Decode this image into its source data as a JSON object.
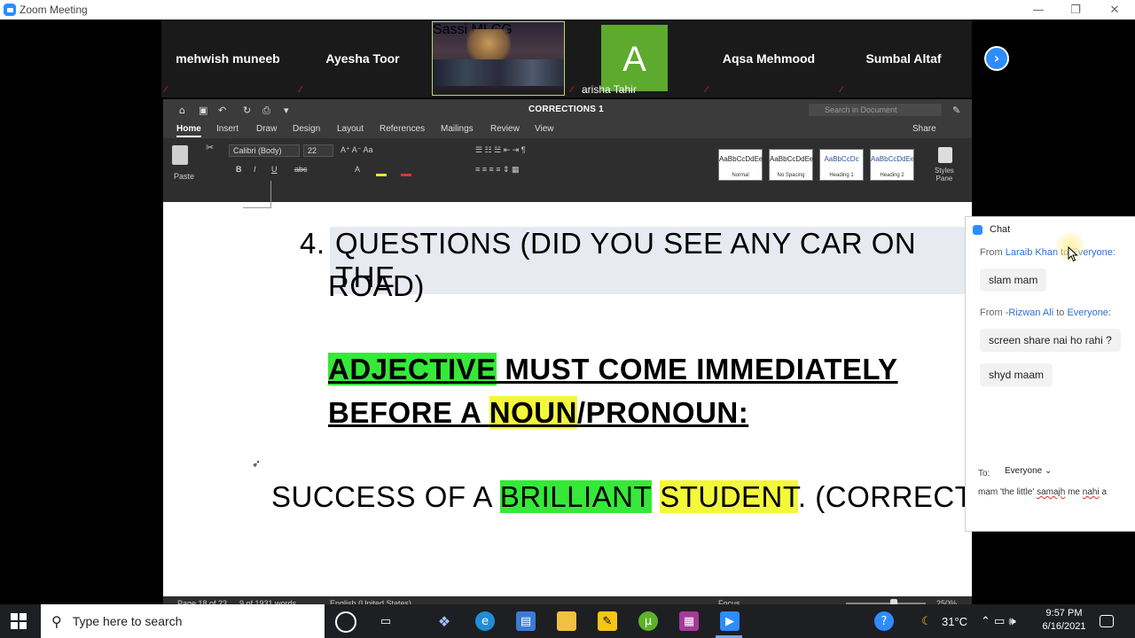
{
  "window": {
    "title": "Zoom Meeting"
  },
  "participants": [
    {
      "name": "mehwish muneeb",
      "muted": true
    },
    {
      "name": "Ayesha Toor",
      "muted": true
    },
    {
      "name": "Sassi MLCG",
      "muted": true,
      "video": true
    },
    {
      "name": "arisha Tahir",
      "muted": true,
      "avatar_letter": "A",
      "avatar_color": "#5eaa2e"
    },
    {
      "name": "Aqsa Mehmood",
      "muted": true
    },
    {
      "name": "Sumbal Altaf",
      "muted": true
    }
  ],
  "word": {
    "doc_title": "CORRECTIONS 1",
    "search_placeholder": "Search in Document",
    "tabs": [
      "Home",
      "Insert",
      "Draw",
      "Design",
      "Layout",
      "References",
      "Mailings",
      "Review",
      "View"
    ],
    "share": "Share",
    "font_name": "Calibri (Body)",
    "font_size": "22",
    "paste": "Paste",
    "styles": [
      {
        "preview": "AaBbCcDdEe",
        "name": "Normal"
      },
      {
        "preview": "AaBbCcDdEe",
        "name": "No Spacing"
      },
      {
        "preview": "AaBbCcDc",
        "name": "Heading 1"
      },
      {
        "preview": "AaBbCcDdEe",
        "name": "Heading 2"
      }
    ],
    "styles_pane": "Styles\nPane",
    "content": {
      "q_num": "4.",
      "q_line1": "QUESTIONS (DID YOU SEE ANY CAR ON THE",
      "q_line2": "ROAD)",
      "rule_adj": "ADJECTIVE",
      "rule_rest1": " MUST COME IMMEDIATELY",
      "rule_before": "BEFORE A ",
      "rule_noun": "NOUN",
      "rule_rest2": "/PRONOUN:",
      "ex_pre": "SUCCESS OF A ",
      "ex_brilliant": "BRILLIANT",
      "ex_space": " ",
      "ex_student": "STUDENT",
      "ex_post": ". (CORRECT)"
    },
    "status": {
      "page": "Page 18 of 23",
      "words": "9 of 1931 words",
      "language": "English (United States)",
      "focus": "Focus",
      "zoom": "250%"
    }
  },
  "chat": {
    "title": "Chat",
    "messages": [
      {
        "from_label": "From",
        "sender": "Laraib Khan",
        "to_label": "to",
        "to": "Everyone:",
        "text": "slam mam"
      },
      {
        "from_label": "From",
        "sender": "-Rizwan Ali",
        "to_label": "to",
        "to": "Everyone:",
        "texts": [
          "screen share nai ho rahi ?",
          "shyd maam"
        ]
      }
    ],
    "to_label": "To:",
    "to_value": "Everyone",
    "input_pre": "mam 'the little' ",
    "input_sp1": "samajh",
    "input_mid": " me ",
    "input_sp2": "nahi",
    "input_post": " a"
  },
  "taskbar": {
    "search_placeholder": "Type here to search",
    "temperature": "31°C",
    "time": "9:57 PM",
    "date": "6/16/2021"
  }
}
